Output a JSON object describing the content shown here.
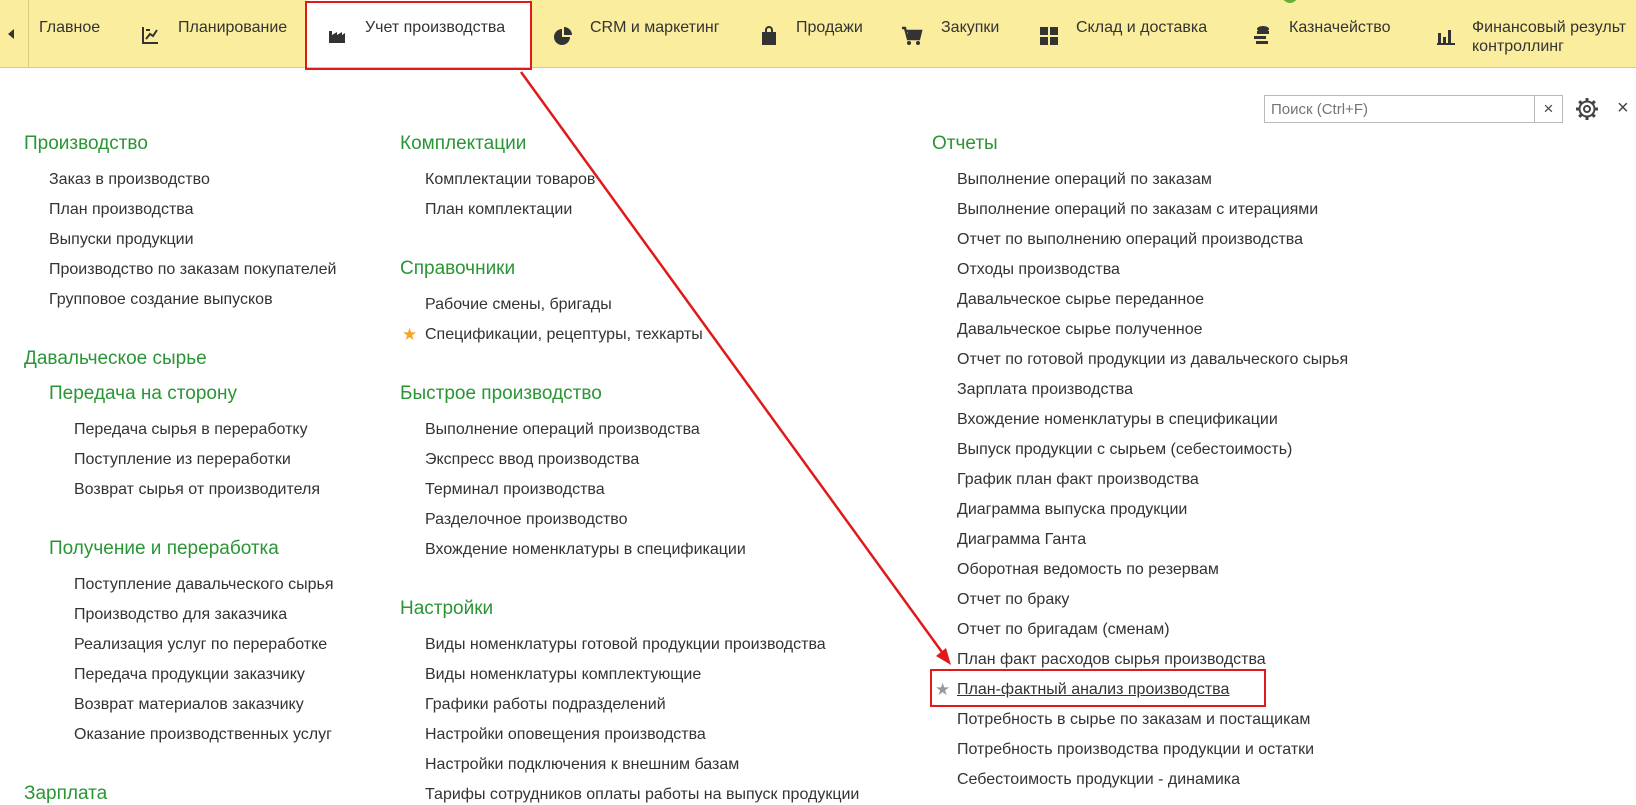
{
  "nav": {
    "tabs": [
      {
        "label": "Главное",
        "icon": "none"
      },
      {
        "label": "Планирование",
        "icon": "planning-icon"
      },
      {
        "label": "Учет производства",
        "icon": "factory-icon",
        "active": true
      },
      {
        "label": "CRM и маркетинг",
        "icon": "pie-chart-icon"
      },
      {
        "label": "Продажи",
        "icon": "shopping-bag-icon"
      },
      {
        "label": "Закупки",
        "icon": "cart-icon"
      },
      {
        "label": "Склад и доставка",
        "icon": "warehouse-grid-icon"
      },
      {
        "label": "Казначейство",
        "icon": "coins-icon"
      },
      {
        "label": "Финансовый результ",
        "label2": "контроллинг",
        "icon": "bar-chart-icon"
      }
    ]
  },
  "search": {
    "placeholder": "Поиск (Ctrl+F)",
    "clear": "×"
  },
  "close": "×",
  "colors": {
    "nav_bg": "#fbed9e",
    "heading": "#2a9535",
    "highlight": "#e0191b",
    "star": "#f5a623"
  },
  "col1": {
    "production": {
      "title": "Производство",
      "items": [
        "Заказ в производство",
        "План производства",
        "Выпуски продукции",
        "Производство по заказам покупателей",
        "Групповое создание выпусков"
      ]
    },
    "tolling": {
      "title": "Давальческое сырье",
      "outsourcing": {
        "title": "Передача на сторону",
        "items": [
          "Передача сырья в переработку",
          "Поступление из переработки",
          "Возврат сырья от производителя"
        ]
      },
      "receiving": {
        "title": "Получение и переработка",
        "items": [
          "Поступление давальческого сырья",
          "Производство для заказчика",
          "Реализация услуг по переработке",
          "Передача продукции заказчику",
          "Возврат материалов заказчику",
          "Оказание производственных услуг"
        ]
      }
    },
    "salary": {
      "title": "Зарплата"
    }
  },
  "col2": {
    "kits": {
      "title": "Комплектации",
      "items": [
        "Комплектации товаров",
        "План комплектации"
      ]
    },
    "refs": {
      "title": "Справочники",
      "items": [
        "Рабочие смены, бригады",
        "Спецификации, рецептуры, техкарты"
      ]
    },
    "fast": {
      "title": "Быстрое производство",
      "items": [
        "Выполнение операций производства",
        "Экспресс ввод производства",
        "Терминал производства",
        "Разделочное производство",
        "Вхождение номенклатуры в спецификации"
      ]
    },
    "settings": {
      "title": "Настройки",
      "items": [
        "Виды номенклатуры готовой продукции производства",
        "Виды номенклатуры комплектующие",
        "Графики работы подразделений",
        "Настройки оповещения производства",
        "Настройки подключения к внешним базам",
        "Тарифы сотрудников оплаты работы на выпуск продукции"
      ]
    }
  },
  "col3": {
    "reports": {
      "title": "Отчеты",
      "items": [
        "Выполнение операций по заказам",
        "Выполнение операций по заказам с итерациями",
        "Отчет по выполнению операций производства",
        "Отходы производства",
        "Давальческое сырье переданное",
        "Давальческое сырье полученное",
        "Отчет по готовой продукции из давальческого сырья",
        "Зарплата производства",
        "Вхождение номенклатуры в спецификации",
        "Выпуск продукции с сырьем (себестоимость)",
        "График план факт производства",
        "Диаграмма выпуска продукции",
        "Диаграмма Ганта",
        "Оборотная ведомость по резервам",
        "Отчет по браку",
        "Отчет по бригадам (сменам)",
        "План факт расходов сырья производства",
        "План-фактный анализ производства",
        "Потребность в сырье по заказам и постащикам",
        "Потребность производства продукции и остатки",
        "Себестоимость продукции - динамика"
      ]
    }
  }
}
